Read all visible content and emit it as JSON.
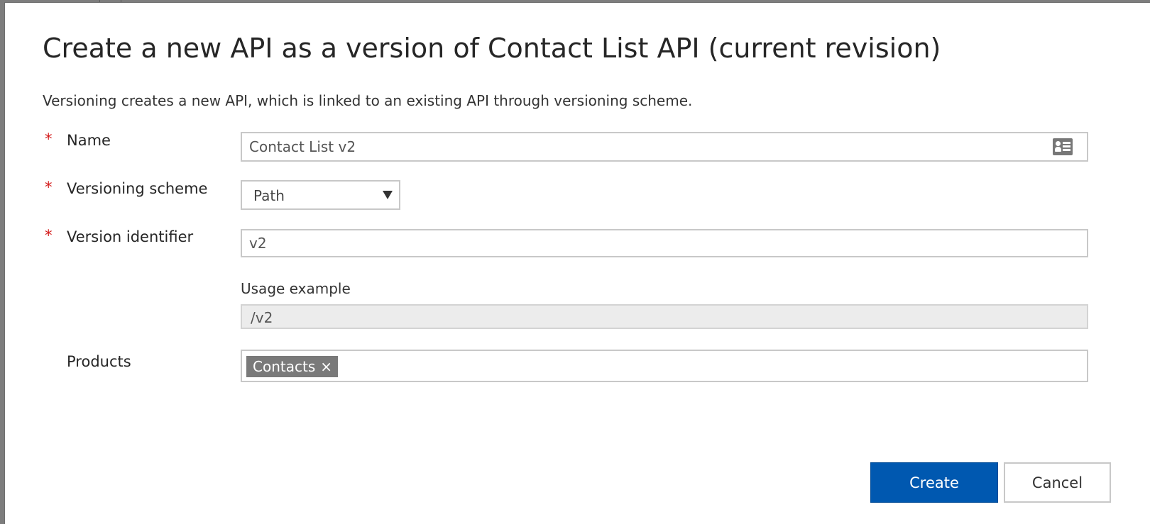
{
  "dialog": {
    "title": "Create a new API as a version of Contact List API (current revision)",
    "description": "Versioning creates a new API, which is linked to an existing API through versioning scheme."
  },
  "form": {
    "required_marker": "*",
    "name": {
      "label": "Name",
      "value": "Contact List v2",
      "icon": "contact-card-icon"
    },
    "versioning_scheme": {
      "label": "Versioning scheme",
      "value": "Path"
    },
    "version_identifier": {
      "label": "Version identifier",
      "value": "v2"
    },
    "usage_example": {
      "label": "Usage example",
      "value": "/v2"
    },
    "products": {
      "label": "Products",
      "tags": [
        "Contacts"
      ],
      "remove_glyph": "×"
    }
  },
  "actions": {
    "create_label": "Create",
    "cancel_label": "Cancel"
  },
  "colors": {
    "primary": "#0058b0",
    "required": "#d31a1a",
    "tag": "#7a7a7a"
  }
}
